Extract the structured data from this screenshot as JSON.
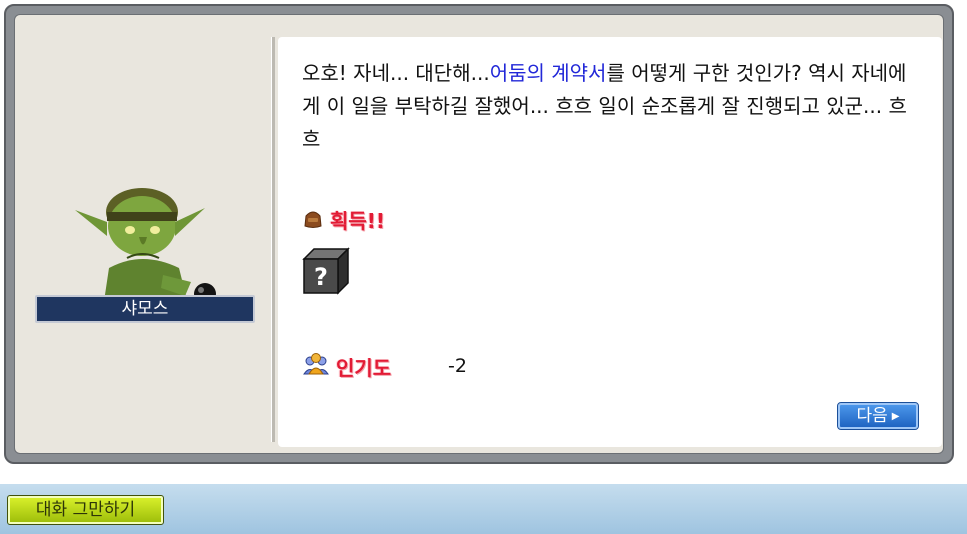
{
  "npc": {
    "name": "샤모스"
  },
  "dialogue": {
    "prefix": "오호! 자네... 대단해...",
    "highlight": "어둠의 계약서",
    "suffix": "를 어떻게 구한 것인가? 역시 자네에게 이 일을 부탁하길 잘했어... 흐흐 일이 순조롭게 잘 진행되고 있군... 흐흐",
    "highlight_color": "#2228d8"
  },
  "rewards": {
    "acquire_label": "획득!!",
    "item_symbol": "?",
    "fame_label": "인기도",
    "fame_value": "-2"
  },
  "buttons": {
    "next_label": "다음",
    "end_chat_label": "대화 그만하기"
  },
  "icons": {
    "bag": "bag-icon",
    "item": "unknown-item-icon",
    "fame": "people-icon",
    "next_arrow": "arrow-right-icon"
  }
}
